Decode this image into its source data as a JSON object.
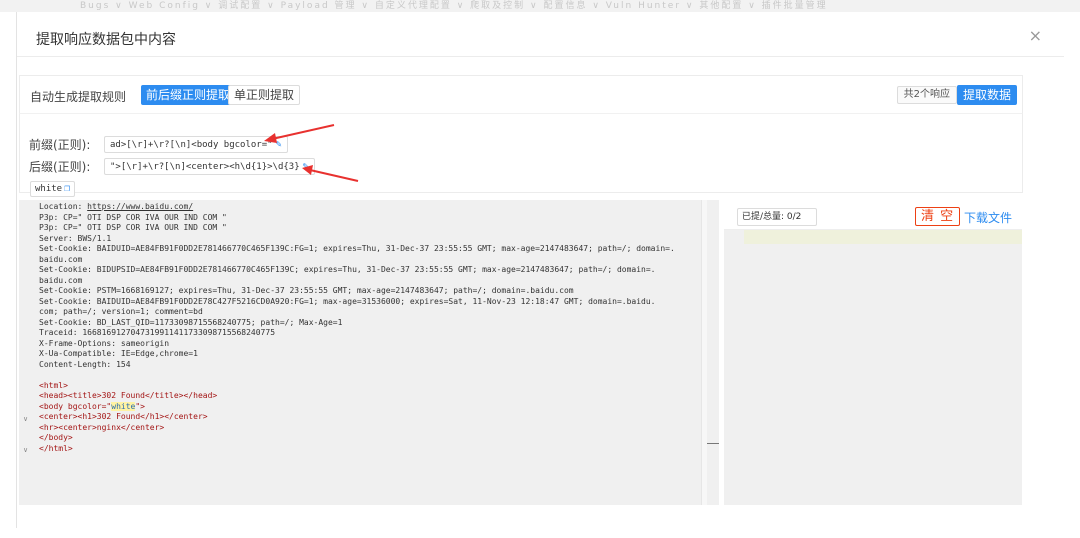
{
  "background_tabs_text": "Bugs ∨ Web Config ∨ 调试配置 ∨ Payload 管理 ∨ 自定义代理配置 ∨ 爬取及控制 ∨ 配置信息 ∨ Vuln Hunter ∨ 其他配置 ∨ 插件批量管理",
  "dialog": {
    "title": "提取响应数据包中内容",
    "close_label": "×"
  },
  "toolbar": {
    "auto_rule_label": "自动生成提取规则",
    "tab_prefix_suffix": "前后缀正则提取",
    "tab_single_regex": "单正则提取",
    "count_tag": "共2个响应",
    "extract_button": "提取数据"
  },
  "rules": {
    "prefix_label": "前缀(正则):",
    "prefix_value": "ad>[\\r]+\\r?[\\n]<body bgcolor=\"",
    "suffix_label": "后缀(正则):",
    "suffix_value": "\">[\\r]+\\r?[\\n]<center><h\\d{1}>\\d{3}",
    "result_value": "white"
  },
  "response": {
    "headers": [
      "Location: https://www.baidu.com/",
      "P3p: CP=\" OTI DSP COR IVA OUR IND COM \"",
      "P3p: CP=\" OTI DSP COR IVA OUR IND COM \"",
      "Server: BWS/1.1",
      "Set-Cookie: BAIDUID=AE84FB91F0DD2E781466770C465F139C:FG=1; expires=Thu, 31-Dec-37 23:55:55 GMT; max-age=2147483647; path=/; domain=.",
      "baidu.com",
      "Set-Cookie: BIDUPSID=AE84FB91F0DD2E781466770C465F139C; expires=Thu, 31-Dec-37 23:55:55 GMT; max-age=2147483647; path=/; domain=.",
      "baidu.com",
      "Set-Cookie: PSTM=1668169127; expires=Thu, 31-Dec-37 23:55:55 GMT; max-age=2147483647; path=/; domain=.baidu.com",
      "Set-Cookie: BAIDUID=AE84FB91F0DD2E78C427F5216CD0A920:FG=1; max-age=31536000; expires=Sat, 11-Nov-23 12:18:47 GMT; domain=.baidu.",
      "com; path=/; version=1; comment=bd",
      "Set-Cookie: BD_LAST_QID=11733098715568240775; path=/; Max-Age=1",
      "Traceid: 1668169127047319911411733098715568240775",
      "X-Frame-Options: sameorigin",
      "X-Ua-Compatible: IE=Edge,chrome=1",
      "Content-Length: 154"
    ],
    "body": {
      "html_open": "<html>",
      "head_line": "<head><title>302 Found</title></head>",
      "body_open_prefix": "<body bgcolor=\"",
      "body_open_value": "white",
      "body_open_suffix": "\">",
      "center_line": "<center><h1>302 Found</h1></center>",
      "hr_line": "<hr><center>nginx</center>",
      "body_close": "</body>",
      "html_close": "</html>"
    }
  },
  "right_panel": {
    "progress_label": "已提/总量: 0/2",
    "clear_button": "清 空",
    "download_link": "下载文件"
  },
  "colors": {
    "primary": "#2d8cf0",
    "danger": "#ed4014",
    "annotation_arrow": "#e8312f"
  }
}
